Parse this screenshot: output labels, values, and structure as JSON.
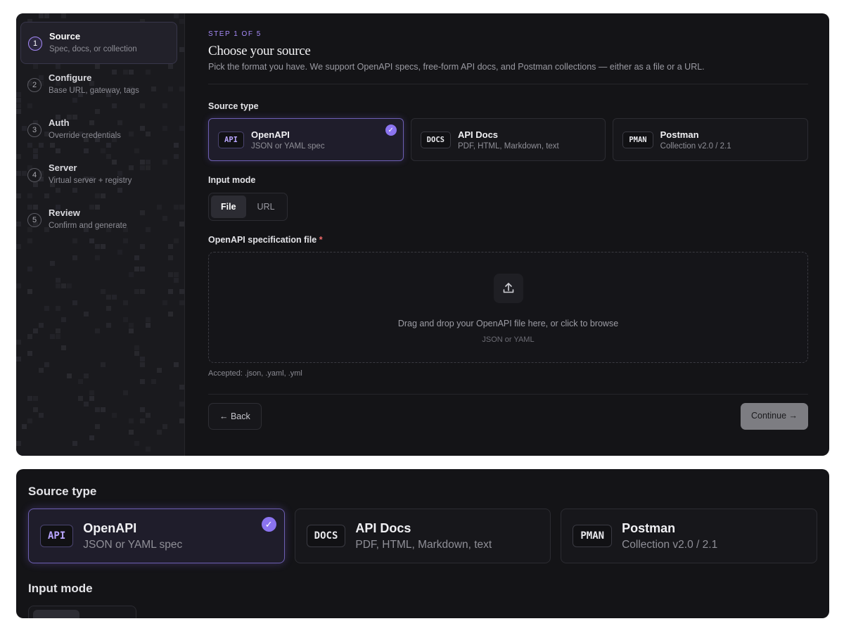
{
  "wizard": {
    "steps": [
      {
        "num": "1",
        "title": "Source",
        "sub": "Spec, docs, or collection",
        "active": true
      },
      {
        "num": "2",
        "title": "Configure",
        "sub": "Base URL, gateway, tags"
      },
      {
        "num": "3",
        "title": "Auth",
        "sub": "Override credentials"
      },
      {
        "num": "4",
        "title": "Server",
        "sub": "Virtual server + registry"
      },
      {
        "num": "5",
        "title": "Review",
        "sub": "Confirm and generate"
      }
    ]
  },
  "main": {
    "step_label": "STEP 1 OF 5",
    "title": "Choose your source",
    "description": "Pick the format you have. We support OpenAPI specs, free-form API docs, and Postman collections — either as a file or a URL.",
    "source_type_label": "Source type",
    "source_types": [
      {
        "badge": "API",
        "title": "OpenAPI",
        "sub": "JSON or YAML spec",
        "selected": true
      },
      {
        "badge": "DOCS",
        "title": "API Docs",
        "sub": "PDF, HTML, Markdown, text"
      },
      {
        "badge": "PMAN",
        "title": "Postman",
        "sub": "Collection v2.0 / 2.1"
      }
    ],
    "input_mode_label": "Input mode",
    "input_modes": [
      "File",
      "URL"
    ],
    "selected_mode": "File",
    "file_label": "OpenAPI specification file",
    "required_marker": "*",
    "dropzone_text": "Drag and drop your OpenAPI file here, or click to browse",
    "dropzone_sub": "JSON or YAML",
    "accepted": "Accepted: .json, .yaml, .yml",
    "back_label": "← Back",
    "continue_label": "Continue →"
  },
  "zoom": {
    "source_type_label": "Source type",
    "input_mode_label": "Input mode"
  },
  "colors": {
    "accent": "#a78bfa",
    "check": "#8b74f0",
    "panel_bg": "#141417",
    "required": "#f06a6a"
  },
  "icons": {
    "check": "check-icon",
    "upload": "upload-icon"
  }
}
